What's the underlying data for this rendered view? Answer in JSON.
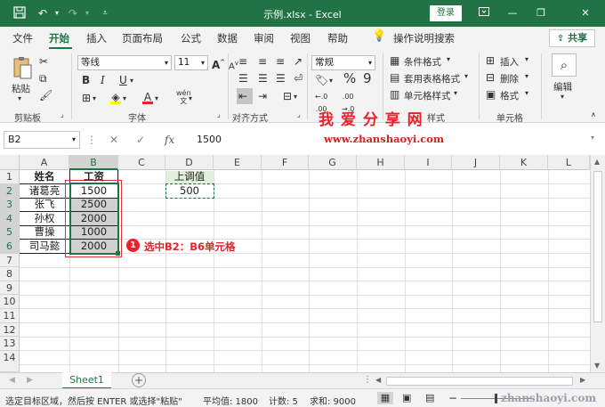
{
  "titlebar": {
    "title": "示例.xlsx  -  Excel",
    "login_label": "登录",
    "save_icon": "save-icon",
    "undo_icon": "undo-icon",
    "redo_icon": "redo-icon"
  },
  "menu": {
    "items": [
      "文件",
      "开始",
      "插入",
      "页面布局",
      "公式",
      "数据",
      "审阅",
      "视图",
      "帮助"
    ],
    "active": "开始",
    "tell_me": "操作说明搜索",
    "share_label": "共享"
  },
  "ribbon": {
    "clipboard": {
      "paste_label": "粘贴",
      "group_label": "剪贴板"
    },
    "font": {
      "name": "等线",
      "size": "11",
      "group_label": "字体",
      "bold": "B",
      "italic": "I",
      "underline": "U"
    },
    "alignment": {
      "group_label": "对齐方式"
    },
    "number": {
      "format": "常规",
      "percent": "%",
      "comma": "9"
    },
    "styles": {
      "conditional": "条件格式",
      "table": "套用表格格式",
      "cell_styles": "单元格样式",
      "group_label": "样式"
    },
    "cells": {
      "insert": "插入",
      "delete": "删除",
      "format": "格式",
      "group_label": "单元格"
    },
    "editing": {
      "label": "编辑"
    }
  },
  "watermark": {
    "text": "我 爱 分 享 网",
    "url": "www.zhanshaoyi.com"
  },
  "formula_bar": {
    "name_box": "B2",
    "value": "1500",
    "fx": "fx"
  },
  "grid": {
    "columns": [
      "A",
      "B",
      "C",
      "D",
      "E",
      "F",
      "G",
      "H",
      "I",
      "J",
      "K",
      "L"
    ],
    "rows": [
      "1",
      "2",
      "3",
      "4",
      "5",
      "6",
      "7",
      "8",
      "9",
      "10",
      "11",
      "12",
      "13",
      "14"
    ],
    "header_name": "姓名",
    "header_salary": "工资",
    "names": [
      "诸葛亮",
      "张飞",
      "孙权",
      "曹操",
      "司马懿"
    ],
    "salaries": [
      "1500",
      "2500",
      "2000",
      "1000",
      "2000"
    ],
    "adjust_label": "上调值",
    "adjust_value": "500"
  },
  "annotation": {
    "number": "1",
    "text": "选中B2：B6单元格"
  },
  "sheets": {
    "active": "Sheet1"
  },
  "status": {
    "hint": "选定目标区域，然后按 ENTER 或选择\"粘贴\"",
    "average": "平均值: 1800",
    "count": "计数: 5",
    "sum": "求和: 9000",
    "watermark_url": "zhanshaoyi.com"
  }
}
